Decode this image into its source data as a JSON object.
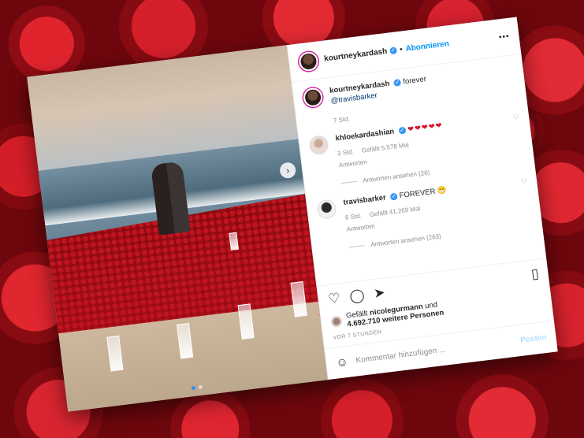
{
  "header": {
    "username": "kourtneykardash",
    "separator": "•",
    "follow_label": "Abonnieren",
    "more_label": "•••"
  },
  "caption": {
    "username": "kourtneykardash",
    "text": "forever",
    "mention": "@travisbarker",
    "time": "7 Std."
  },
  "comments": [
    {
      "username": "khloekardashian",
      "text": "❤❤❤❤❤",
      "time": "3 Std.",
      "likes": "Gefällt 5.578 Mal",
      "reply_label": "Antworten",
      "view_replies": "Antworten ansehen (26)"
    },
    {
      "username": "travisbarker",
      "text": "FOREVER 😁",
      "time": "6 Std.",
      "likes": "Gefällt 41.269 Mal",
      "reply_label": "Antworten",
      "view_replies": "Antworten ansehen (263)"
    }
  ],
  "likes": {
    "prefix": "Gefällt",
    "user": "nicolegurmann",
    "connector": "und",
    "others": "4.692.710 weitere Personen"
  },
  "timestamp": "VOR 7 STUNDEN",
  "composer": {
    "placeholder": "Kommentar hinzufügen ...",
    "post_label": "Posten",
    "emoji_icon": "☺"
  },
  "icons": {
    "heart": "♡",
    "comment": "◯",
    "share": "➤",
    "bookmark": "▯",
    "next": "›"
  },
  "colors": {
    "accent": "#0095f6",
    "heart_red": "#d51328",
    "verified": "#3897f0"
  }
}
